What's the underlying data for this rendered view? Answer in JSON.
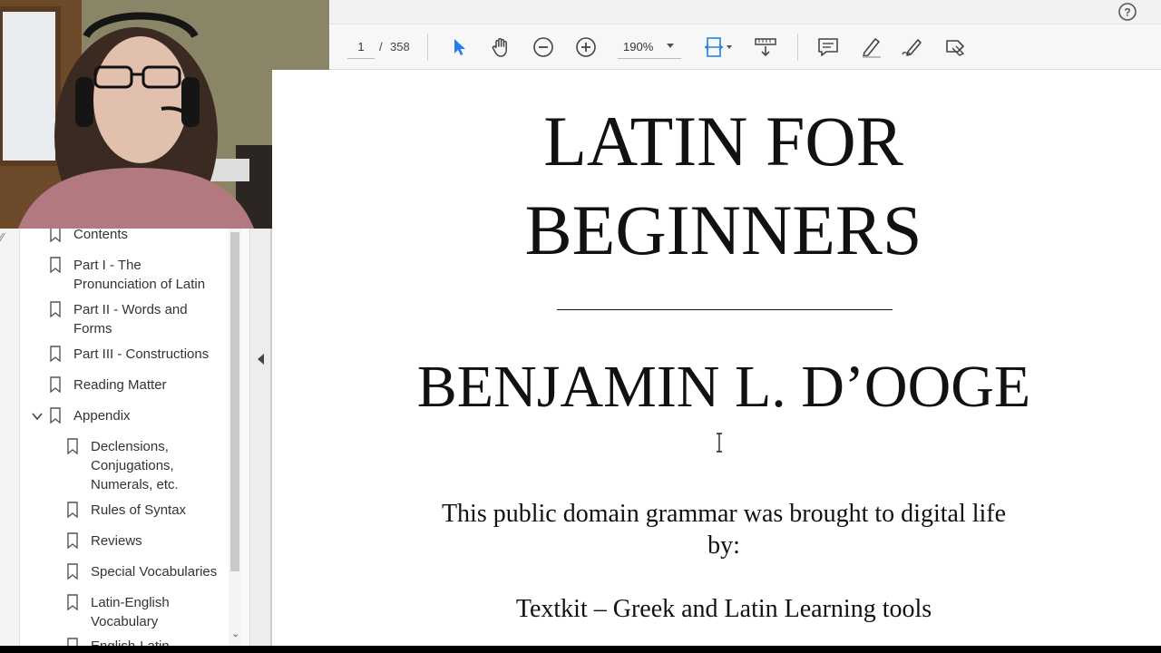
{
  "toolbar": {
    "page_current": "1",
    "page_separator": "/",
    "page_total": "358",
    "zoom": "190%",
    "icons": [
      "select-arrow-icon",
      "hand-icon",
      "zoom-out-icon",
      "zoom-in-icon",
      "fit-page-icon",
      "scroll-mode-icon",
      "comment-icon",
      "highlight-icon",
      "sign-icon",
      "more-tools-icon"
    ],
    "accent": "#2680eb"
  },
  "help_icon": "help-icon",
  "bookmarks": {
    "items": [
      {
        "label": "Contents",
        "level": 0
      },
      {
        "label": "Part I - The Pronunciation of Latin",
        "level": 0
      },
      {
        "label": "Part II - Words and Forms",
        "level": 0
      },
      {
        "label": "Part III - Constructions",
        "level": 0
      },
      {
        "label": "Reading Matter",
        "level": 0
      },
      {
        "label": "Appendix",
        "level": 0,
        "expanded": true
      },
      {
        "label": "Declensions, Conjugations, Numerals, etc.",
        "level": 1
      },
      {
        "label": "Rules of Syntax",
        "level": 1
      },
      {
        "label": "Reviews",
        "level": 1
      },
      {
        "label": "Special Vocabularies",
        "level": 1
      },
      {
        "label": "Latin-English Vocabulary",
        "level": 1
      },
      {
        "label": "English-Latin",
        "level": 1
      }
    ]
  },
  "document": {
    "title_line1": "LATIN FOR",
    "title_line2": "BEGINNERS",
    "author": "BENJAMIN L. D’OOGE",
    "credit_line1": "This public domain grammar was brought to digital life",
    "credit_line2": "by:",
    "credit_line3": "Textkit – Greek and Latin Learning tools"
  }
}
